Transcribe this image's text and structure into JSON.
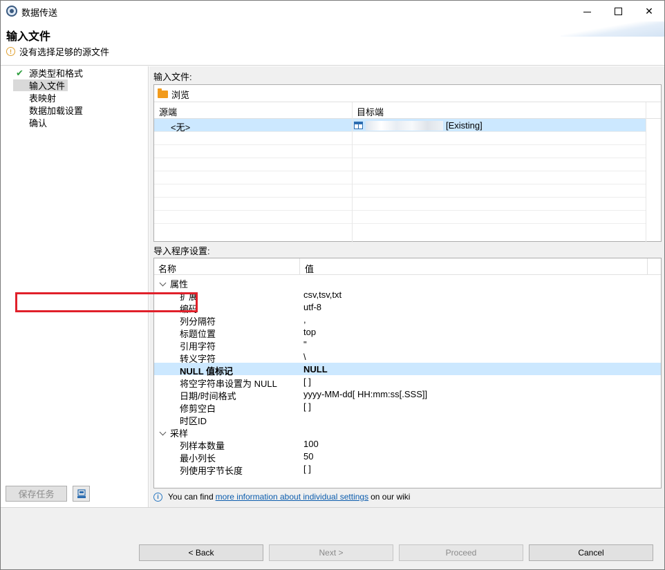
{
  "window": {
    "title": "数据传送",
    "icon": "dbeaver-app-icon"
  },
  "header": {
    "title": "输入文件",
    "message": "没有选择足够的源文件",
    "message_icon": "warning-icon"
  },
  "nav": {
    "items": [
      {
        "label": "源类型和格式",
        "done": true
      },
      {
        "label": "输入文件",
        "selected": true
      },
      {
        "label": "表映射"
      },
      {
        "label": "数据加载设置"
      },
      {
        "label": "确认"
      }
    ],
    "save_task_label": "保存任务"
  },
  "files": {
    "section_label": "输入文件:",
    "browse_label": "浏览",
    "columns": [
      "源端",
      "目标端"
    ],
    "rows": [
      {
        "source": "<无>",
        "target_suffix": "[Existing]"
      }
    ]
  },
  "settings": {
    "section_label": "导入程序设置:",
    "columns": [
      "名称",
      "值"
    ],
    "groups": [
      {
        "name": "属性",
        "props": [
          {
            "name": "扩展",
            "value": "csv,tsv,txt"
          },
          {
            "name": "编码",
            "value": "utf-8"
          },
          {
            "name": "列分隔符",
            "value": ","
          },
          {
            "name": "标题位置",
            "value": "top"
          },
          {
            "name": "引用字符",
            "value": "\""
          },
          {
            "name": "转义字符",
            "value": "\\"
          },
          {
            "name": "NULL 值标记",
            "value": "NULL",
            "selected": true
          },
          {
            "name": "将空字符串设置为 NULL",
            "value": "[ ]"
          },
          {
            "name": "日期/时间格式",
            "value": "yyyy-MM-dd[ HH:mm:ss[.SSS]]"
          },
          {
            "name": "修剪空白",
            "value": "[ ]"
          },
          {
            "name": "时区ID",
            "value": ""
          }
        ]
      },
      {
        "name": "采样",
        "props": [
          {
            "name": "列样本数量",
            "value": "100"
          },
          {
            "name": "最小列长",
            "value": "50"
          },
          {
            "name": "列使用字节长度",
            "value": "[ ]"
          }
        ]
      }
    ]
  },
  "info": {
    "prefix": "You can find",
    "link": "more information about individual settings",
    "suffix": "on our wiki"
  },
  "buttons": {
    "back": "< Back",
    "next": "Next >",
    "proceed": "Proceed",
    "cancel": "Cancel"
  },
  "colors": {
    "selection": "#cce8ff",
    "highlight_border": "#e0202a",
    "check": "#2e9e3e",
    "folder": "#f29b1c",
    "link": "#0b5cad"
  }
}
